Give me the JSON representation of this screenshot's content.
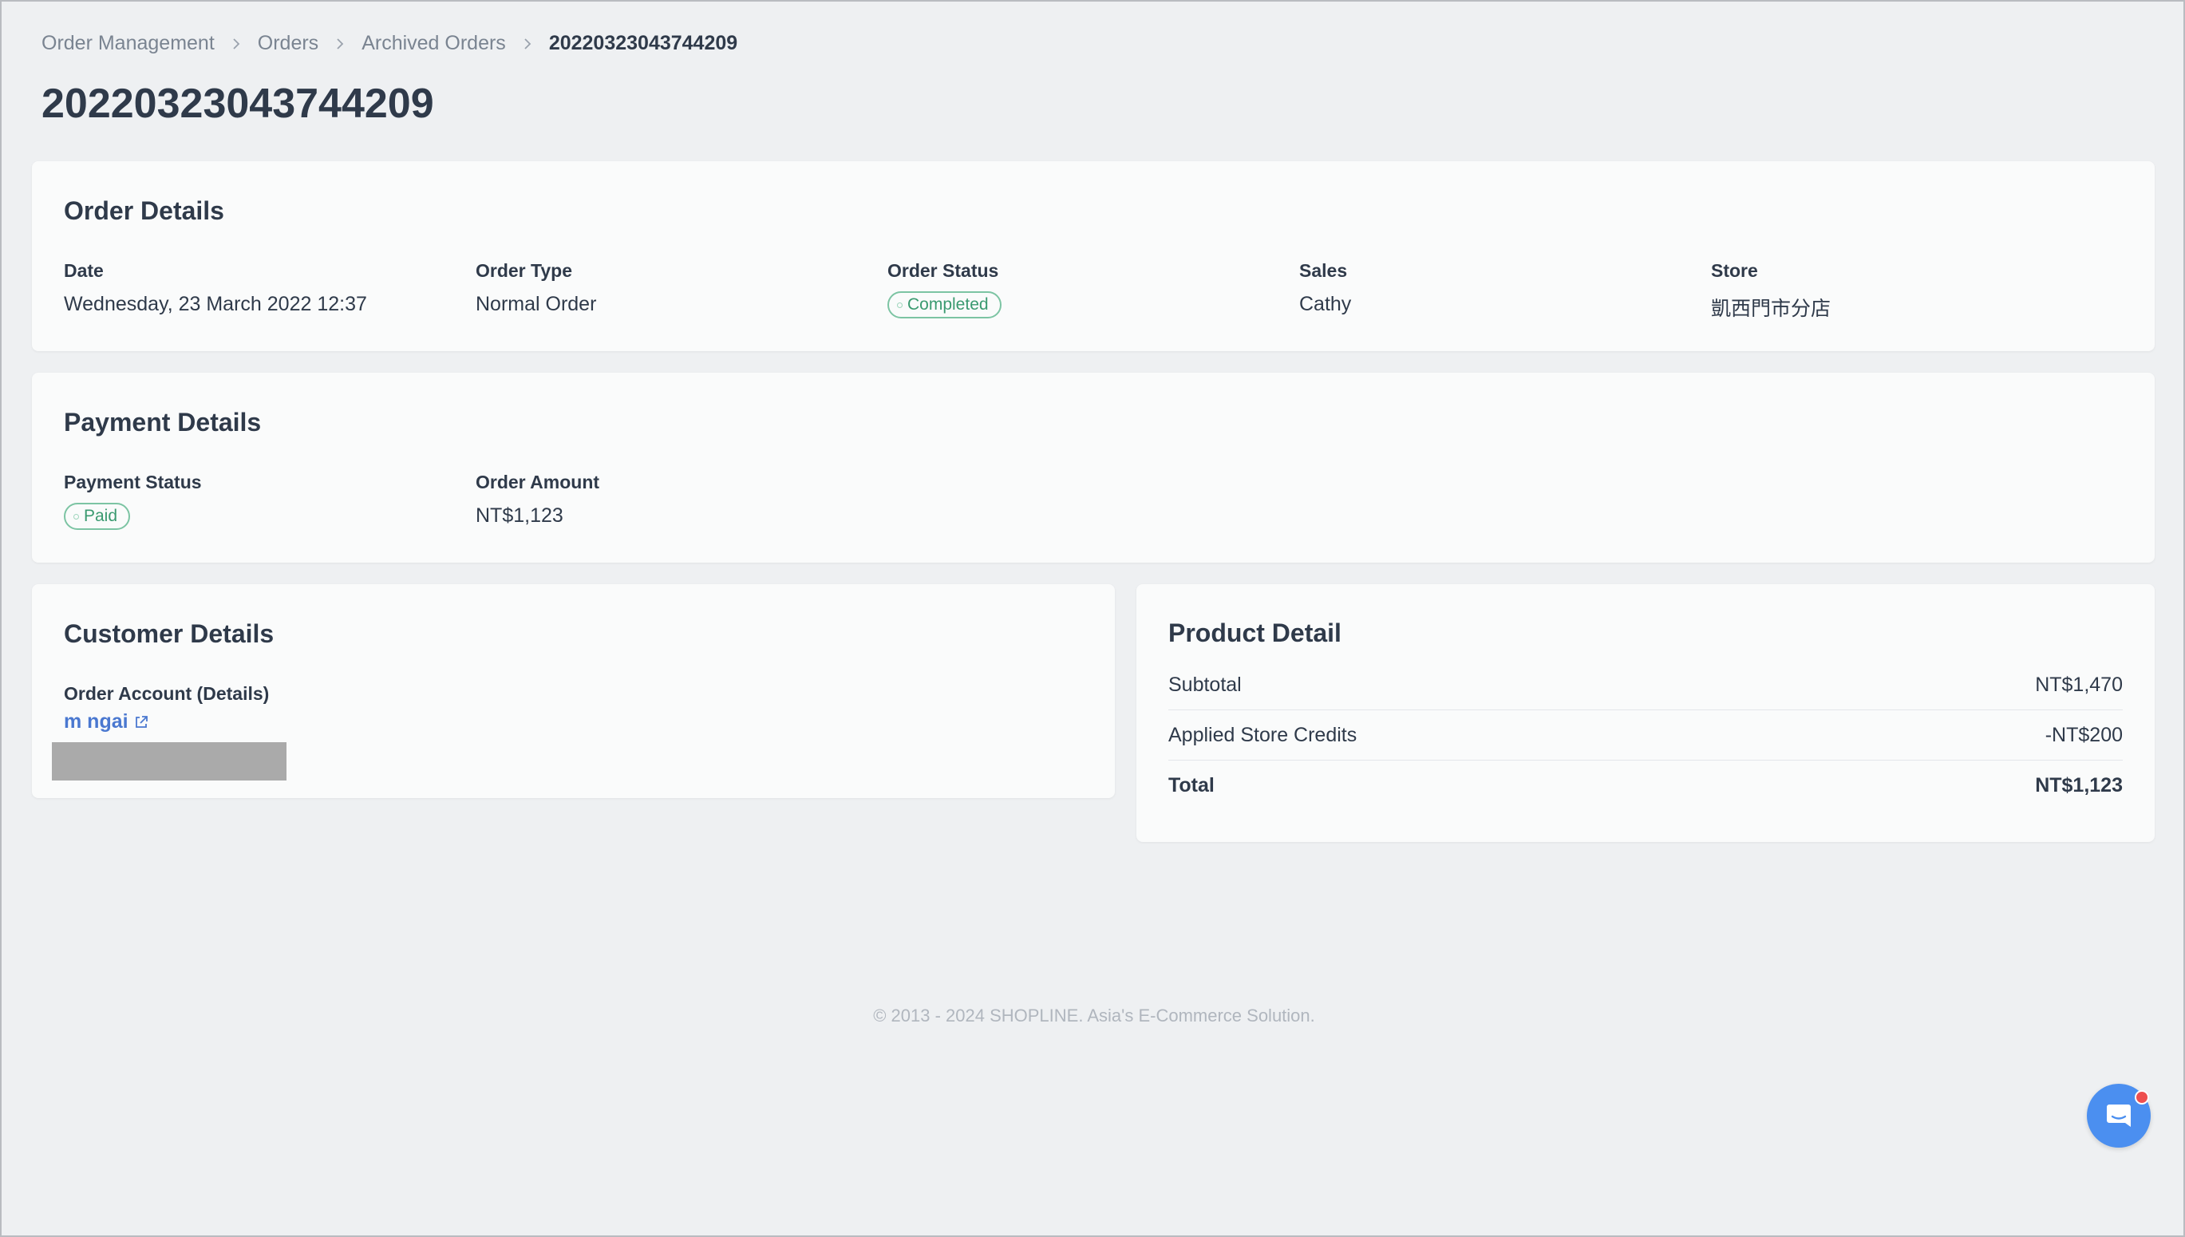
{
  "breadcrumb": {
    "items": [
      "Order Management",
      "Orders",
      "Archived Orders"
    ],
    "current": "20220323043744209"
  },
  "page_title": "20220323043744209",
  "order_details": {
    "title": "Order Details",
    "date_label": "Date",
    "date_value": "Wednesday, 23 March 2022 12:37",
    "type_label": "Order Type",
    "type_value": "Normal Order",
    "status_label": "Order Status",
    "status_value": "Completed",
    "sales_label": "Sales",
    "sales_value": "Cathy",
    "store_label": "Store",
    "store_value": "凱西門市分店"
  },
  "payment_details": {
    "title": "Payment Details",
    "status_label": "Payment Status",
    "status_value": "Paid",
    "amount_label": "Order Amount",
    "amount_value": "NT$1,123"
  },
  "customer_details": {
    "title": "Customer Details",
    "account_label": "Order Account (Details)",
    "account_name": "m ngai"
  },
  "product_detail": {
    "title": "Product Detail",
    "rows": [
      {
        "label": "Subtotal",
        "value": "NT$1,470"
      },
      {
        "label": "Applied Store Credits",
        "value": "-NT$200"
      },
      {
        "label": "Total",
        "value": "NT$1,123"
      }
    ]
  },
  "footer": "© 2013 - 2024 SHOPLINE. Asia's E-Commerce Solution.",
  "icons": {
    "breadcrumb_separator": "chevron-right-icon",
    "external_link": "external-link-icon",
    "chat": "chat-icon"
  },
  "colors": {
    "status_success": "#3a9a70",
    "link": "#4a78d0",
    "chat_button": "#4b8ff0",
    "notification": "#ee4f4f"
  }
}
